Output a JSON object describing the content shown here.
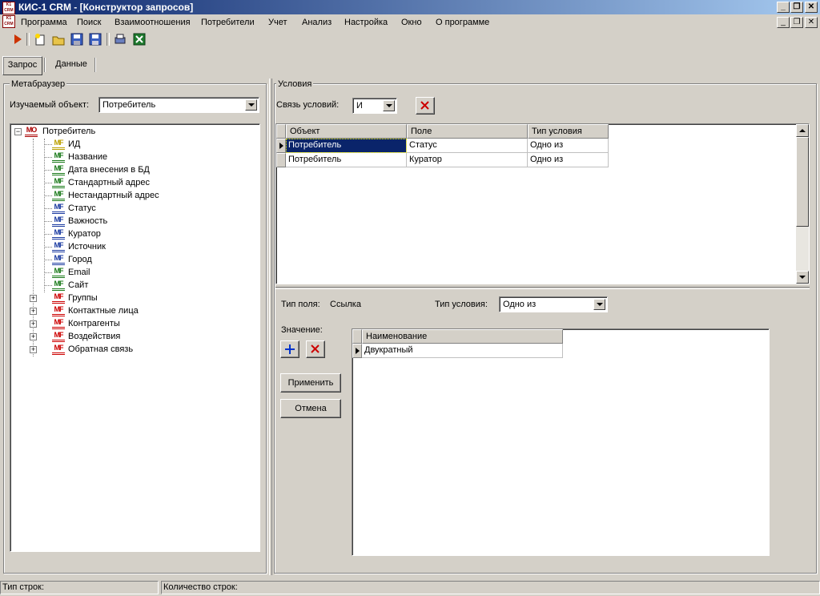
{
  "window": {
    "title": "КИС-1 CRM - [Конструктор запросов]",
    "icon_text": "K1 CRM"
  },
  "menu": [
    "Программа",
    "Поиск",
    "Взаимоотношения",
    "Потребители",
    "Учет",
    "Анализ",
    "Настройка",
    "Окно",
    "О программе"
  ],
  "toolbar": {
    "icons": [
      "run-icon",
      "new-icon",
      "open-icon",
      "save-icon",
      "save-as-icon",
      "print-icon",
      "excel-icon"
    ]
  },
  "tabs": [
    "Запрос",
    "Данные"
  ],
  "metabrowser": {
    "title": "Метабраузер",
    "object_label": "Изучаемый объект:",
    "object_value": "Потребитель",
    "tree": {
      "root_badge": "МО",
      "root": "Потребитель",
      "field_badge": "МF",
      "fields": [
        "ИД",
        "Название",
        "Дата внесения в БД",
        "Стандартный адрес",
        "Нестандартный адрес",
        "Статус",
        "Важность",
        "Куратор",
        "Источник",
        "Город",
        "Email",
        "Сайт"
      ],
      "groups": [
        "Группы",
        "Контактные лица",
        "Контрагенты",
        "Воздействия",
        "Обратная связь"
      ]
    }
  },
  "conditions": {
    "title": "Условия",
    "link_label": "Связь условий:",
    "link_value": "И",
    "columns": [
      "Объект",
      "Поле",
      "Тип условия"
    ],
    "rows": [
      {
        "object": "Потребитель",
        "field": "Статус",
        "type": "Одно из"
      },
      {
        "object": "Потребитель",
        "field": "Куратор",
        "type": "Одно из"
      }
    ]
  },
  "detail": {
    "field_type_label": "Тип поля:",
    "field_type_value": "Ссылка",
    "cond_type_label": "Тип условия:",
    "cond_type_value": "Одно из",
    "value_label": "Значение:",
    "apply": "Применить",
    "cancel": "Отмена",
    "value_column": "Наименование",
    "values": [
      "Двукратный"
    ]
  },
  "status": {
    "rows_type": "Тип строк:",
    "rows_count": "Количество строк:"
  },
  "colors": {
    "title_bar": "#0a246a",
    "selection": "#0a246a",
    "face": "#d4d0c8",
    "delete_red": "#cc0000",
    "add_blue": "#0033cc"
  }
}
